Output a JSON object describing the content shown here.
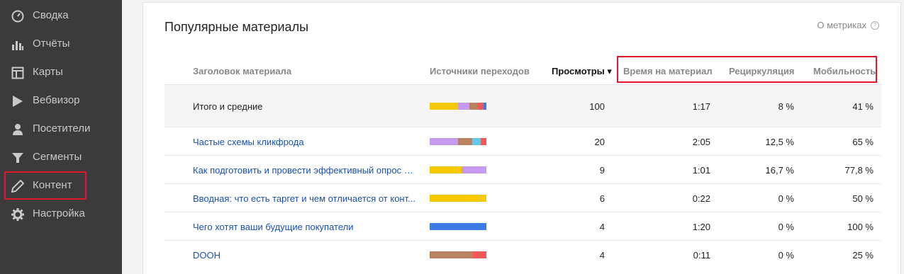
{
  "sidebar": {
    "items": [
      {
        "label": "Сводка",
        "icon": "gauge-icon"
      },
      {
        "label": "Отчёты",
        "icon": "bar-chart-icon"
      },
      {
        "label": "Карты",
        "icon": "map-icon"
      },
      {
        "label": "Вебвизор",
        "icon": "play-icon"
      },
      {
        "label": "Посетители",
        "icon": "user-icon"
      },
      {
        "label": "Сегменты",
        "icon": "filter-icon"
      },
      {
        "label": "Контент",
        "icon": "pencil-icon"
      },
      {
        "label": "Настройка",
        "icon": "gear-icon"
      }
    ],
    "highlighted_item": "Контент"
  },
  "card": {
    "title": "Популярные материалы",
    "metrics_link": "О метриках",
    "columns": {
      "title": "Заголовок материала",
      "sources": "Источники переходов",
      "views": "Просмотры ▾",
      "time": "Время на материал",
      "recirculation": "Рециркуляция",
      "mobility": "Мобильность"
    },
    "rows": [
      {
        "title": "Итого и средние",
        "views": "100",
        "time": "1:17",
        "recirculation": "8 %",
        "mobility": "41 %"
      },
      {
        "title": "Частые схемы кликфрода",
        "views": "20",
        "time": "2:05",
        "recirculation": "12,5 %",
        "mobility": "65 %"
      },
      {
        "title": "Как подготовить и провести эффективный опрос а...",
        "views": "9",
        "time": "1:01",
        "recirculation": "16,7 %",
        "mobility": "77,8 %"
      },
      {
        "title": "Вводная: что есть таргет и чем отличается от конт...",
        "views": "6",
        "time": "0:22",
        "recirculation": "0 %",
        "mobility": "50 %"
      },
      {
        "title": "Чего хотят ваши будущие покупатели",
        "views": "4",
        "time": "1:20",
        "recirculation": "0 %",
        "mobility": "100 %"
      },
      {
        "title": "DOOH",
        "views": "4",
        "time": "0:11",
        "recirculation": "0 %",
        "mobility": "25 %"
      }
    ],
    "source_bars": [
      [
        {
          "color": "#f5c800",
          "share": 0.5
        },
        {
          "color": "#c79af1",
          "share": 0.2
        },
        {
          "color": "#b98160",
          "share": 0.15
        },
        {
          "color": "#f05a5a",
          "share": 0.1
        },
        {
          "color": "#3d7ce6",
          "share": 0.05
        }
      ],
      [
        {
          "color": "#c79af1",
          "share": 0.5
        },
        {
          "color": "#b98160",
          "share": 0.25
        },
        {
          "color": "#66c8e8",
          "share": 0.15
        },
        {
          "color": "#f05a5a",
          "share": 0.1
        }
      ],
      [
        {
          "color": "#f5c800",
          "share": 0.56
        },
        {
          "color": "#c79af1",
          "share": 0.44
        }
      ],
      [
        {
          "color": "#f5c800",
          "share": 1.0
        }
      ],
      [
        {
          "color": "#3d7ce6",
          "share": 1.0
        }
      ],
      [
        {
          "color": "#b98160",
          "share": 0.75
        },
        {
          "color": "#f05a5a",
          "share": 0.25
        }
      ]
    ],
    "highlight_color": "#e0182a"
  }
}
